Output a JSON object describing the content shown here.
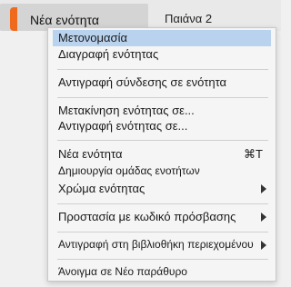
{
  "tabs": {
    "active_label": "Νέα ενότητα",
    "active_color": "#f06a1e",
    "other_label": "Παιάνα 2"
  },
  "menu": {
    "items": [
      {
        "label": "Μετονομασία",
        "highlighted": true
      },
      {
        "label": "Διαγραφή ενότητας"
      },
      {
        "label": "Αντιγραφή σύνδεσης σε ενότητα"
      },
      {
        "label": "Μετακίνηση ενότητας σε..."
      },
      {
        "label": "Αντιγραφή ενότητας σε..."
      },
      {
        "label": "Νέα ενότητα",
        "shortcut": "⌘T"
      },
      {
        "label": "Δημιουργία ομάδας ενοτήτων"
      },
      {
        "label": "Χρώμα ενότητας",
        "submenu": true
      },
      {
        "label": "Προστασία με κωδικό πρόσβασης",
        "submenu": true
      },
      {
        "label": "Αντιγραφή στη βιβλιοθήκη περιεχομένου",
        "submenu": true
      },
      {
        "label": "Άνοιγμα σε Νέο παράθυρο"
      }
    ]
  }
}
